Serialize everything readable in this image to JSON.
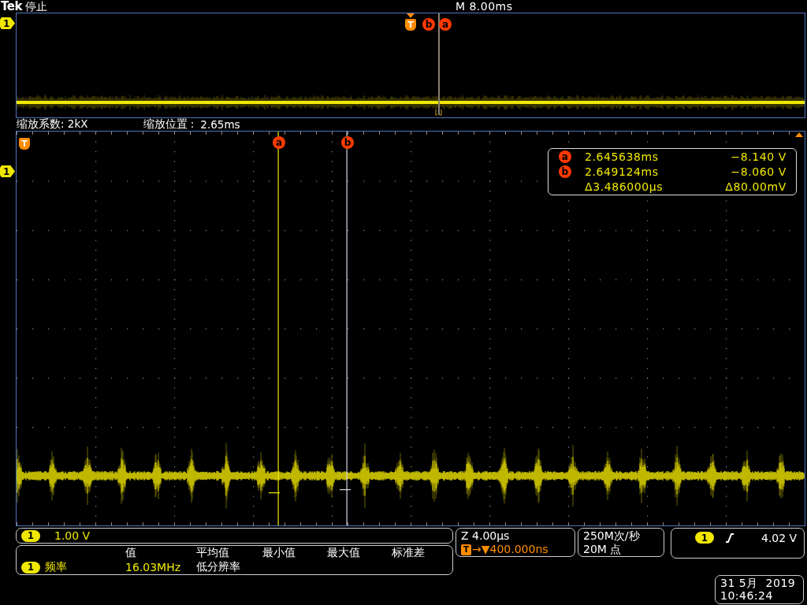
{
  "header": {
    "brand": "Tek",
    "run_state": "停止",
    "timebase": "M 8.00ms"
  },
  "overview": {
    "channel_marker": "1",
    "markers": [
      {
        "label": "T",
        "kind": "trigger"
      },
      {
        "label": "b",
        "kind": "cursor"
      },
      {
        "label": "a",
        "kind": "cursor"
      }
    ]
  },
  "zoom_info": {
    "factor": "缩放系数: 2kX",
    "position_label": "缩放位置 :",
    "position": "2.65ms"
  },
  "main": {
    "trigger_marker": "T",
    "channel_marker": "1",
    "cursors": [
      {
        "label": "a",
        "kind": "a"
      },
      {
        "label": "b",
        "kind": "b"
      }
    ],
    "readout": [
      {
        "marker": "a",
        "time": "2.645638ms",
        "value": "−8.140 V"
      },
      {
        "marker": "b",
        "time": "2.649124ms",
        "value": "−8.060 V"
      },
      {
        "time": "Δ3.486000µs",
        "value": "Δ80.00mV"
      }
    ]
  },
  "channel_bar": {
    "channel": "1",
    "scale": "1.00 V"
  },
  "measurements": {
    "columns": [
      "值",
      "平均值",
      "最小值",
      "最大值",
      "标准差"
    ],
    "rows": [
      {
        "channel": "1",
        "name": "频率",
        "value": "16.03MHz",
        "note": "低分辨率"
      }
    ]
  },
  "horizontal": {
    "zoom": "Z 4.00µs",
    "trigger_icon": "T",
    "delay": "→▼400.000ns"
  },
  "acquisition": {
    "rate": "250M次/秒",
    "points": "20M 点"
  },
  "trigger": {
    "channel": "1",
    "level": "4.02 V"
  },
  "datetime": {
    "date": "31 5月  2019",
    "time": "10:46:24"
  }
}
